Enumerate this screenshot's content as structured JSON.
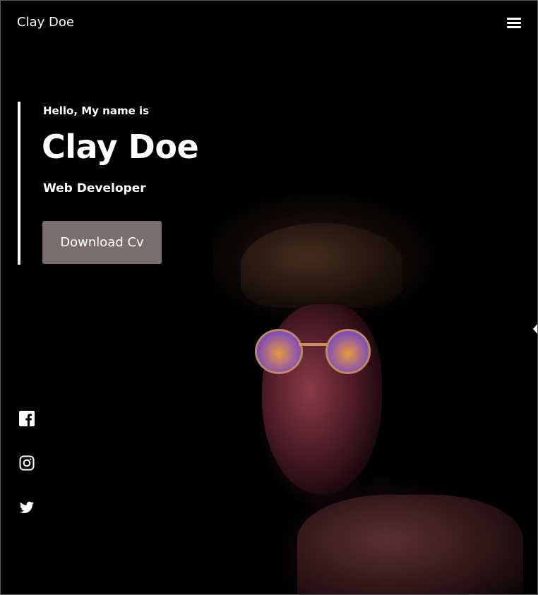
{
  "header": {
    "brand": "Clay Doe",
    "menu_icon": "hamburger-menu-icon"
  },
  "hero": {
    "greeting": "Hello, My name is",
    "name": "Clay Doe",
    "role": "Web Developer",
    "download_label": "Download Cv"
  },
  "social": {
    "icons": [
      "facebook-icon",
      "instagram-icon",
      "twitter-icon"
    ]
  },
  "colors": {
    "background": "#000000",
    "text": "#ffffff",
    "button": "#7c6e6e"
  }
}
